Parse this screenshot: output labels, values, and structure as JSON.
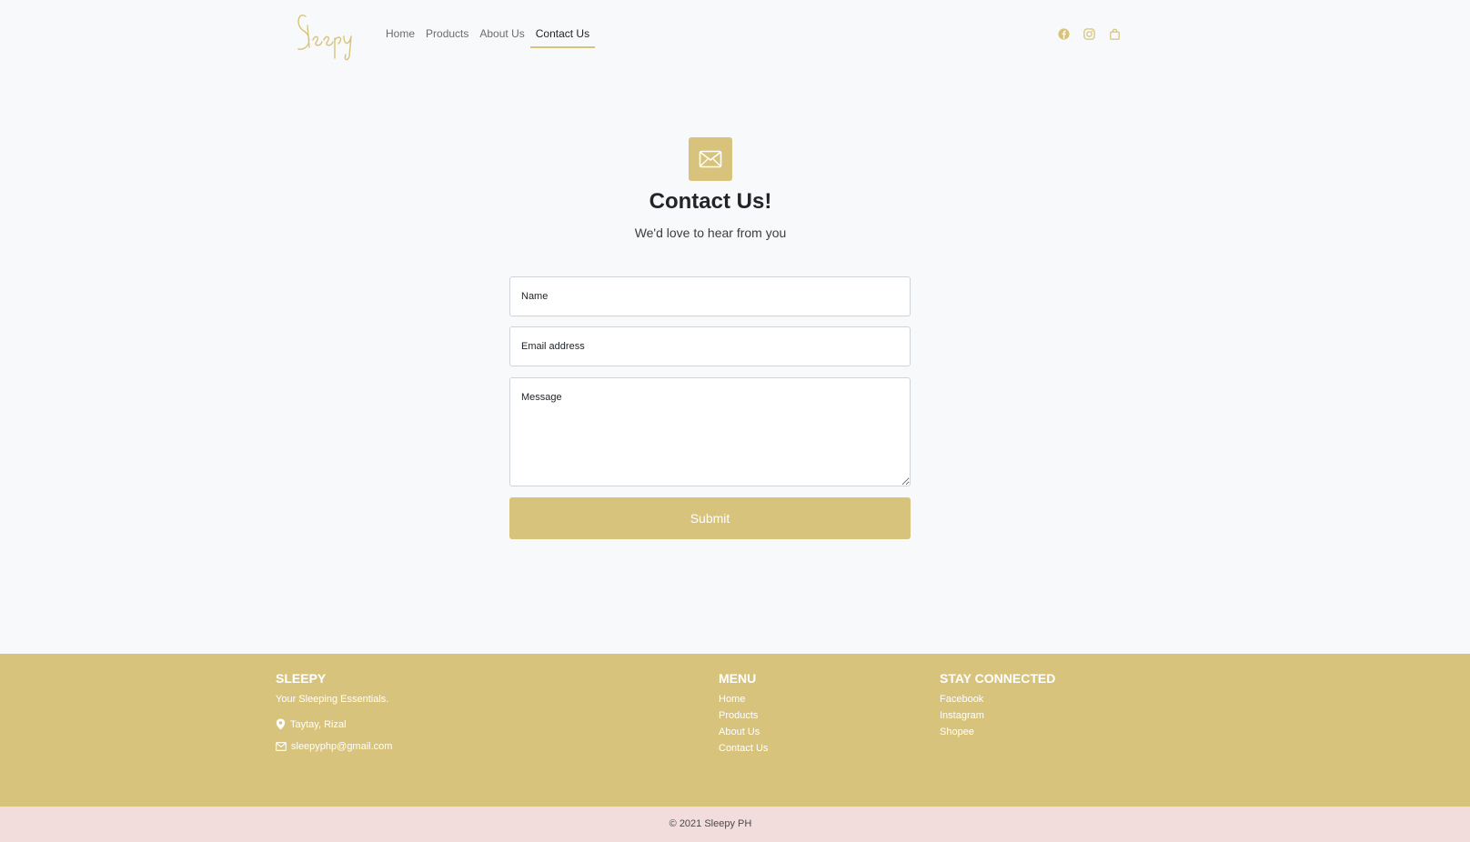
{
  "brand": {
    "logo_text": "Sleepy",
    "accent": "#d8c37d"
  },
  "nav": {
    "links": [
      "Home",
      "Products",
      "About Us",
      "Contact Us"
    ],
    "active": "Contact Us",
    "icons": [
      "facebook-icon",
      "instagram-icon",
      "shopping-bag-icon"
    ]
  },
  "contact": {
    "icon": "envelope-icon",
    "title": "Contact Us!",
    "subtitle": "We'd love to hear from you"
  },
  "form": {
    "name_placeholder": "Name",
    "email_placeholder": "Email address",
    "message_placeholder": "Message",
    "submit_label": "Submit"
  },
  "footer": {
    "brand_heading": "SLEEPY",
    "tagline": "Your Sleeping Essentials.",
    "location": "Taytay, Rizal",
    "email": "sleepyphp@gmail.com",
    "menu_heading": "MENU",
    "menu_items": [
      "Home",
      "Products",
      "About Us",
      "Contact Us"
    ],
    "social_heading": "STAY CONNECTED",
    "social_items": [
      "Facebook",
      "Instagram",
      "Shopee"
    ],
    "background": "#d8c37d"
  },
  "copyright": "© 2021 Sleepy PH"
}
